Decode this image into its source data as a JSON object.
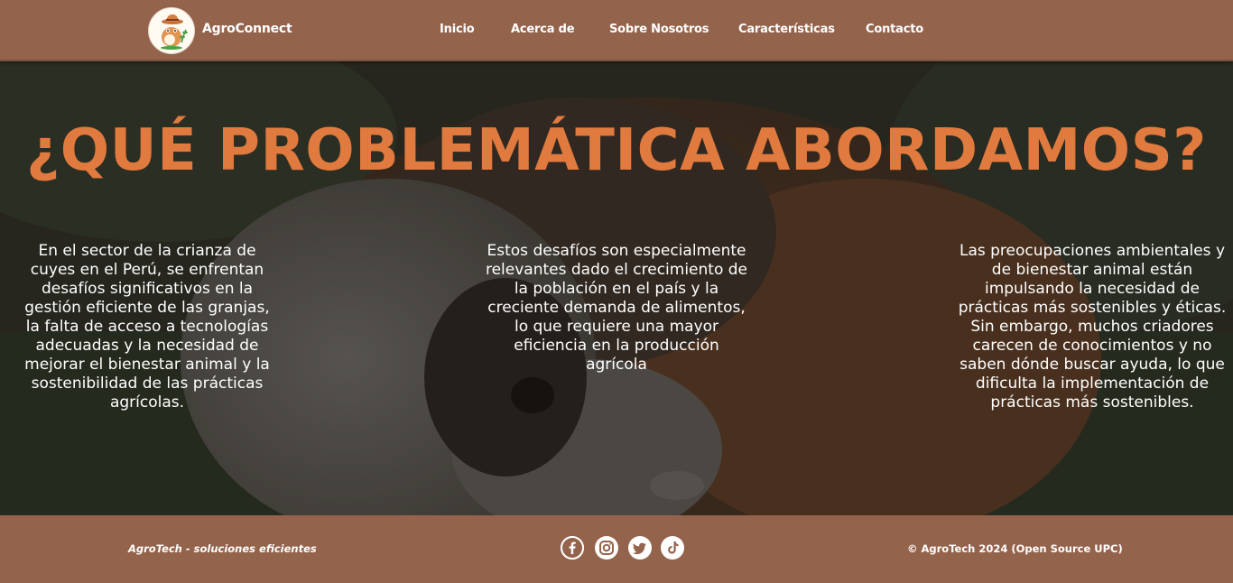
{
  "header": {
    "brand": "AgroConnect",
    "logo_icon": "guinea-pig-farmer-logo",
    "nav": [
      "Inicio",
      "Acerca de",
      "Sobre Nosotros",
      "Características",
      "Contacto"
    ]
  },
  "hero": {
    "title": "¿QUÉ PROBLEMÁTICA ABORDAMOS?",
    "background": "guinea-pig-photo",
    "paragraphs": [
      "En el sector de la crianza de cuyes en el Perú, se enfrentan desafíos significativos en la gestión eficiente de las granjas, la falta de acceso a tecnologías adecuadas y la necesidad de mejorar el bienestar animal y la sostenibilidad de las prácticas agrícolas.",
      "Estos desafíos son especialmente relevantes dado el crecimiento de la población en el país y la creciente demanda de alimentos, lo que requiere una mayor eficiencia en la producción agrícola",
      "Las preocupaciones ambientales y de bienestar animal están impulsando la necesidad de prácticas más sostenibles y éticas. Sin embargo, muchos criadores carecen de conocimientos y no saben dónde buscar ayuda, lo que dificulta la implementación de prácticas más sostenibles."
    ]
  },
  "footer": {
    "tagline": "AgroTech - soluciones eficientes",
    "copyright": "© AgroTech 2024 (Open Source UPC)",
    "social_icons": [
      "facebook-icon",
      "instagram-icon",
      "twitter-icon",
      "tiktok-icon"
    ]
  },
  "colors": {
    "header_bg": "#94634c",
    "accent_title": "#e07a3e",
    "text": "#ffffff"
  }
}
